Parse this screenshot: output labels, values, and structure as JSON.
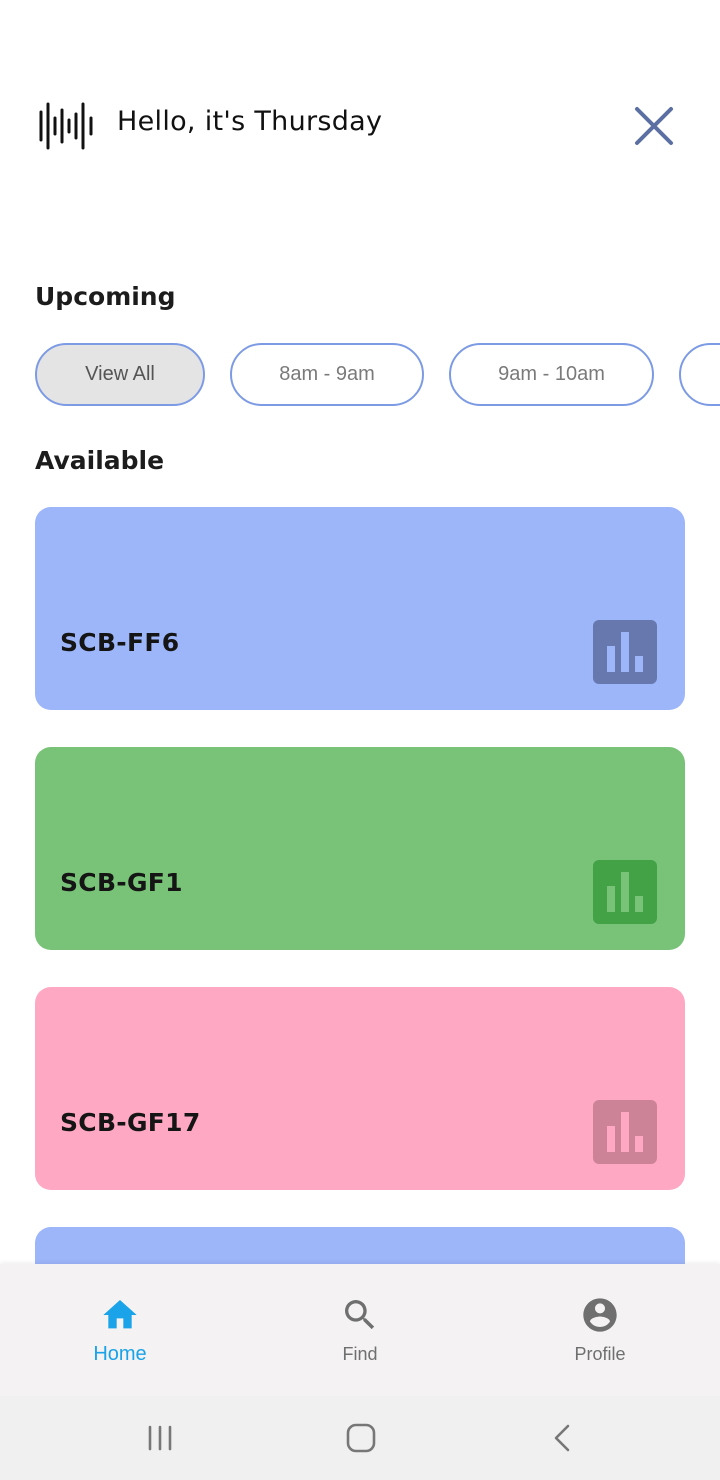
{
  "header": {
    "greeting": "Hello, it's Thursday",
    "logo_icon": "sound-wave-icon",
    "close_icon": "close-icon",
    "accent_color": "#5b6fa3"
  },
  "upcoming": {
    "title": "Upcoming",
    "chips": [
      {
        "label": "View All",
        "active": true
      },
      {
        "label": "8am - 9am",
        "active": false
      },
      {
        "label": "9am - 10am",
        "active": false
      },
      {
        "label": "",
        "active": false
      }
    ],
    "chip_border_color": "#7d9be4"
  },
  "available": {
    "title": "Available",
    "rooms": [
      {
        "name": "SCB-FF6",
        "color": "#9db6fa",
        "icon_bg": "#6678ae",
        "icon_fg": "#9db6fa",
        "icon": "bar-chart-icon"
      },
      {
        "name": "SCB-GF1",
        "color": "#79c378",
        "icon_bg": "#43a146",
        "icon_fg": "#79c378",
        "icon": "bar-chart-icon"
      },
      {
        "name": "SCB-GF17",
        "color": "#fea8c3",
        "icon_bg": "#cc8397",
        "icon_fg": "#fea8c3",
        "icon": "bar-chart-icon"
      },
      {
        "name": "",
        "color": "#9db6fa",
        "icon_bg": "#6678ae",
        "icon_fg": "#9db6fa",
        "icon": "bar-chart-icon"
      }
    ]
  },
  "bottom_nav": {
    "items": [
      {
        "label": "Home",
        "icon": "home-icon",
        "active": true
      },
      {
        "label": "Find",
        "icon": "search-icon",
        "active": false
      },
      {
        "label": "Profile",
        "icon": "account-circle-icon",
        "active": false
      }
    ],
    "active_color": "#1aa3e8",
    "inactive_color": "#6f6f6f"
  },
  "system_nav": {
    "buttons": [
      "recent-apps-icon",
      "home-circle-icon",
      "back-icon"
    ]
  }
}
